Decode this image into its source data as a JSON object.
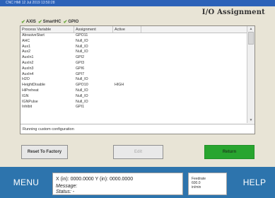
{
  "window": {
    "titlebar_text": "CNC HMI   12 Jul 2019 13:50:28",
    "title": "I/O Assignment"
  },
  "tabs": [
    {
      "label": "AXIS"
    },
    {
      "label": "SmartHC"
    },
    {
      "label": "GPIO"
    }
  ],
  "table": {
    "headers": [
      "Process Variable",
      "Assignment",
      "Active"
    ],
    "rows": [
      {
        "variable": "AbrasiveStart",
        "assignment": "GPO11",
        "active": ""
      },
      {
        "variable": "AHC",
        "assignment": "Null_IO",
        "active": ""
      },
      {
        "variable": "Aux1",
        "assignment": "Null_IO",
        "active": ""
      },
      {
        "variable": "Aux2",
        "assignment": "Null_IO",
        "active": ""
      },
      {
        "variable": "AuxIn1",
        "assignment": "GPI2",
        "active": ""
      },
      {
        "variable": "AuxIn2",
        "assignment": "GPI3",
        "active": ""
      },
      {
        "variable": "AuxIn3",
        "assignment": "GPI6",
        "active": ""
      },
      {
        "variable": "AuxIn4",
        "assignment": "GPI7",
        "active": ""
      },
      {
        "variable": "H2O",
        "assignment": "Null_IO",
        "active": ""
      },
      {
        "variable": "HeightDisable",
        "assignment": "GPO10",
        "active": "HIGH"
      },
      {
        "variable": "HiPreheat",
        "assignment": "Null_IO",
        "active": ""
      },
      {
        "variable": "IGN",
        "assignment": "Null_IO",
        "active": ""
      },
      {
        "variable": "IGNPulse",
        "assignment": "Null_IO",
        "active": ""
      },
      {
        "variable": "Inhibit",
        "assignment": "GPI1",
        "active": ""
      }
    ]
  },
  "status_line": "Running custom configuration",
  "buttons": {
    "reset": "Reset To Factory",
    "edit": "Edit",
    "return": "Return"
  },
  "footer": {
    "menu": "MENU",
    "help": "HELP",
    "coords": "X (in): 0000.0000    Y (in): 0000.0000",
    "message": "Message:",
    "status": "Status:  -",
    "feedrate_label": "Feedrate",
    "feedrate_value": "600.0",
    "feedrate_unit": "in/min"
  },
  "colors": {
    "titlebar": "#2c62b8",
    "footer": "#2d74ad",
    "return_button": "#28a52f",
    "tab_check": "#67a83a"
  }
}
